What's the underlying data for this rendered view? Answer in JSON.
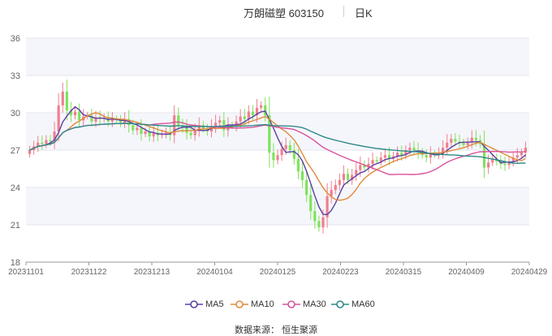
{
  "header": {
    "name": "万朗磁塑 603150",
    "period": "日K"
  },
  "legend": [
    {
      "label": "MA5",
      "color": "#5b3fa3"
    },
    {
      "label": "MA10",
      "color": "#e08a3c"
    },
    {
      "label": "MA30",
      "color": "#d9529b"
    },
    {
      "label": "MA60",
      "color": "#2f8a8a"
    }
  ],
  "source": "数据来源： 恒生聚源",
  "chart_data": {
    "type": "candlestick",
    "title": "万朗磁塑 603150 日K",
    "ylim": [
      18,
      36
    ],
    "yticks": [
      18,
      21,
      24,
      27,
      30,
      33,
      36
    ],
    "xlabels": [
      "20231101",
      "20231122",
      "20231213",
      "20240104",
      "20240125",
      "20240223",
      "20240315",
      "20240409",
      "20240429"
    ],
    "up_color": "#f07e8e",
    "down_color": "#7ee35a",
    "closes": [
      27.0,
      27.3,
      27.6,
      27.5,
      27.8,
      27.7,
      28.5,
      30.6,
      31.7,
      30.2,
      29.8,
      30.1,
      29.4,
      29.7,
      29.8,
      29.3,
      29.6,
      29.5,
      29.6,
      29.3,
      29.5,
      29.4,
      29.2,
      29.5,
      29.0,
      28.6,
      28.8,
      28.3,
      28.5,
      28.1,
      28.4,
      28.2,
      28.3,
      28.4,
      28.2,
      29.8,
      29.0,
      28.8,
      28.4,
      28.2,
      28.6,
      29.0,
      28.7,
      28.5,
      28.9,
      29.2,
      29.4,
      28.6,
      29.0,
      28.9,
      29.3,
      29.7,
      29.5,
      30.1,
      29.8,
      30.4,
      30.6,
      29.8,
      26.8,
      26.2,
      26.6,
      27.1,
      27.4,
      27.0,
      26.3,
      25.3,
      24.6,
      23.4,
      22.1,
      21.3,
      20.8,
      21.6,
      23.3,
      23.8,
      24.2,
      24.6,
      25.1,
      24.6,
      25.0,
      25.4,
      25.8,
      25.6,
      25.9,
      26.2,
      26.1,
      26.4,
      26.6,
      26.3,
      26.5,
      26.8,
      26.6,
      27.0,
      27.2,
      27.0,
      26.8,
      26.6,
      26.4,
      26.7,
      26.6,
      26.8,
      27.2,
      27.6,
      27.9,
      27.7,
      27.6,
      27.4,
      27.6,
      28.0,
      27.8,
      27.5,
      25.6,
      26.0,
      26.3,
      26.1,
      25.9,
      25.8,
      26.1,
      26.4,
      26.6,
      26.8,
      27.2
    ]
  }
}
